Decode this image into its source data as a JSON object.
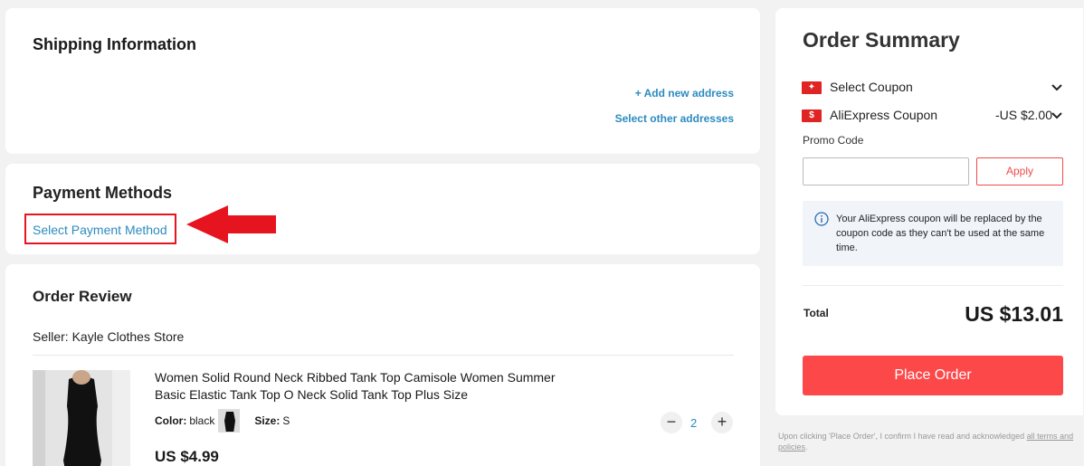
{
  "shipping": {
    "title": "Shipping Information",
    "add_address": "+ Add new address",
    "other_addresses": "Select other addresses"
  },
  "payment": {
    "title": "Payment Methods",
    "select_label": "Select Payment Method",
    "highlight_color": "#e5141f"
  },
  "review": {
    "title": "Order Review",
    "seller": "Seller: Kayle Clothes Store",
    "product": {
      "title": "Women Solid Round Neck Ribbed Tank Top Camisole Women Summer Basic Elastic Tank Top O Neck Solid Tank Top Plus Size",
      "color_label": "Color:",
      "color_value": "black",
      "size_label": "Size:",
      "size_value": "S",
      "price": "US $4.99",
      "quantity": "2",
      "minus": "−",
      "plus": "+"
    }
  },
  "summary": {
    "title": "Order Summary",
    "coupon_select": "Select Coupon",
    "coupon_ali": "AliExpress Coupon",
    "coupon_ali_amount": "-US $2.00",
    "promo_label": "Promo Code",
    "promo_placeholder": "",
    "apply": "Apply",
    "notice": "Your AliExpress coupon will be replaced by the coupon code as they can't be used at the same time.",
    "total_label": "Total",
    "total_value": "US $13.01",
    "place_order": "Place Order",
    "accent_color": "#fd484a"
  },
  "disclaimer": {
    "text": "Upon clicking 'Place Order', I confirm I have read and acknowledged ",
    "link": "all terms and policies",
    "end": "."
  },
  "icons": [
    "coupon-icon",
    "aliexpress-coupon-icon",
    "chevron-down-icon",
    "info-icon",
    "arrow-left-icon"
  ]
}
